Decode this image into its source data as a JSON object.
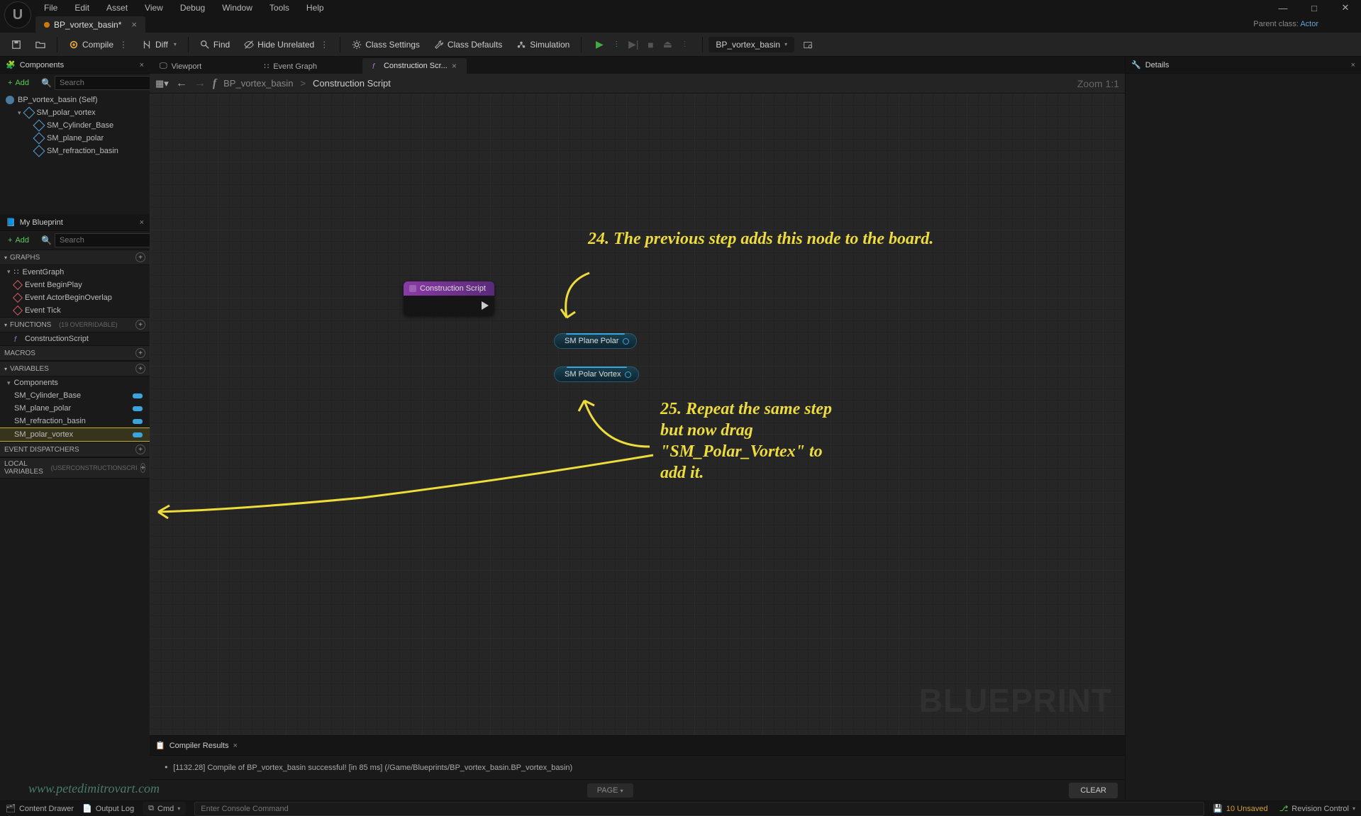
{
  "menu": {
    "items": [
      "File",
      "Edit",
      "Asset",
      "View",
      "Debug",
      "Window",
      "Tools",
      "Help"
    ]
  },
  "parentclass": {
    "label": "Parent class:",
    "link": "Actor"
  },
  "maintab": {
    "title": "BP_vortex_basin*"
  },
  "toolbar": {
    "compile": "Compile",
    "diff": "Diff",
    "find": "Find",
    "hide": "Hide Unrelated",
    "class_settings": "Class Settings",
    "class_defaults": "Class Defaults",
    "simulation": "Simulation",
    "bpselect": "BP_vortex_basin"
  },
  "left": {
    "components_title": "Components",
    "add": "Add",
    "search_placeholder": "Search",
    "tree": [
      {
        "label": "BP_vortex_basin (Self)",
        "indent": 0,
        "type": "root"
      },
      {
        "label": "SM_polar_vortex",
        "indent": 1,
        "type": "comp"
      },
      {
        "label": "SM_Cylinder_Base",
        "indent": 2,
        "type": "comp"
      },
      {
        "label": "SM_plane_polar",
        "indent": 2,
        "type": "comp"
      },
      {
        "label": "SM_refraction_basin",
        "indent": 2,
        "type": "comp"
      }
    ],
    "mybp_title": "My Blueprint",
    "sections": {
      "graphs": "GRAPHS",
      "functions": "FUNCTIONS",
      "functions_note": "(19 OVERRIDABLE)",
      "macros": "MACROS",
      "variables": "VARIABLES",
      "components_sub": "Components",
      "eventdisp": "EVENT DISPATCHERS",
      "localvars": "LOCAL VARIABLES",
      "localvars_note": "(USERCONSTRUCTIONSCRI"
    },
    "graphs": [
      {
        "label": "EventGraph",
        "sub": [
          {
            "label": "Event BeginPlay"
          },
          {
            "label": "Event ActorBeginOverlap"
          },
          {
            "label": "Event Tick"
          }
        ]
      }
    ],
    "functions": [
      {
        "label": "ConstructionScript"
      }
    ],
    "vars": [
      {
        "label": "SM_Cylinder_Base"
      },
      {
        "label": "SM_plane_polar"
      },
      {
        "label": "SM_refraction_basin"
      },
      {
        "label": "SM_polar_vortex",
        "hl": true
      }
    ]
  },
  "center": {
    "tabs": [
      {
        "label": "Viewport"
      },
      {
        "label": "Event Graph"
      },
      {
        "label": "Construction Scr...",
        "active": true
      }
    ],
    "breadcrumb": {
      "root": "BP_vortex_basin",
      "chev": ">",
      "current": "Construction Script"
    },
    "zoom": "Zoom 1:1",
    "csnode": "Construction Script",
    "var1": "SM Plane Polar",
    "var2": "SM Polar Vortex",
    "wm": "BLUEPRINT",
    "annot1": "24. The previous step adds this node to the board.",
    "annot2": "25. Repeat the same step but now drag \"SM_Polar_Vortex\" to add it."
  },
  "right": {
    "title": "Details"
  },
  "compiler": {
    "title": "Compiler Results",
    "msg": "[1132.28] Compile of BP_vortex_basin successful! [in 85 ms] (/Game/Blueprints/BP_vortex_basin.BP_vortex_basin)",
    "page": "PAGE",
    "clear": "CLEAR"
  },
  "status": {
    "content_drawer": "Content Drawer",
    "output_log": "Output Log",
    "cmd": "Cmd",
    "console_placeholder": "Enter Console Command",
    "unsaved": "10 Unsaved",
    "revision": "Revision Control"
  },
  "watermark": "www.petedimitrovart.com"
}
